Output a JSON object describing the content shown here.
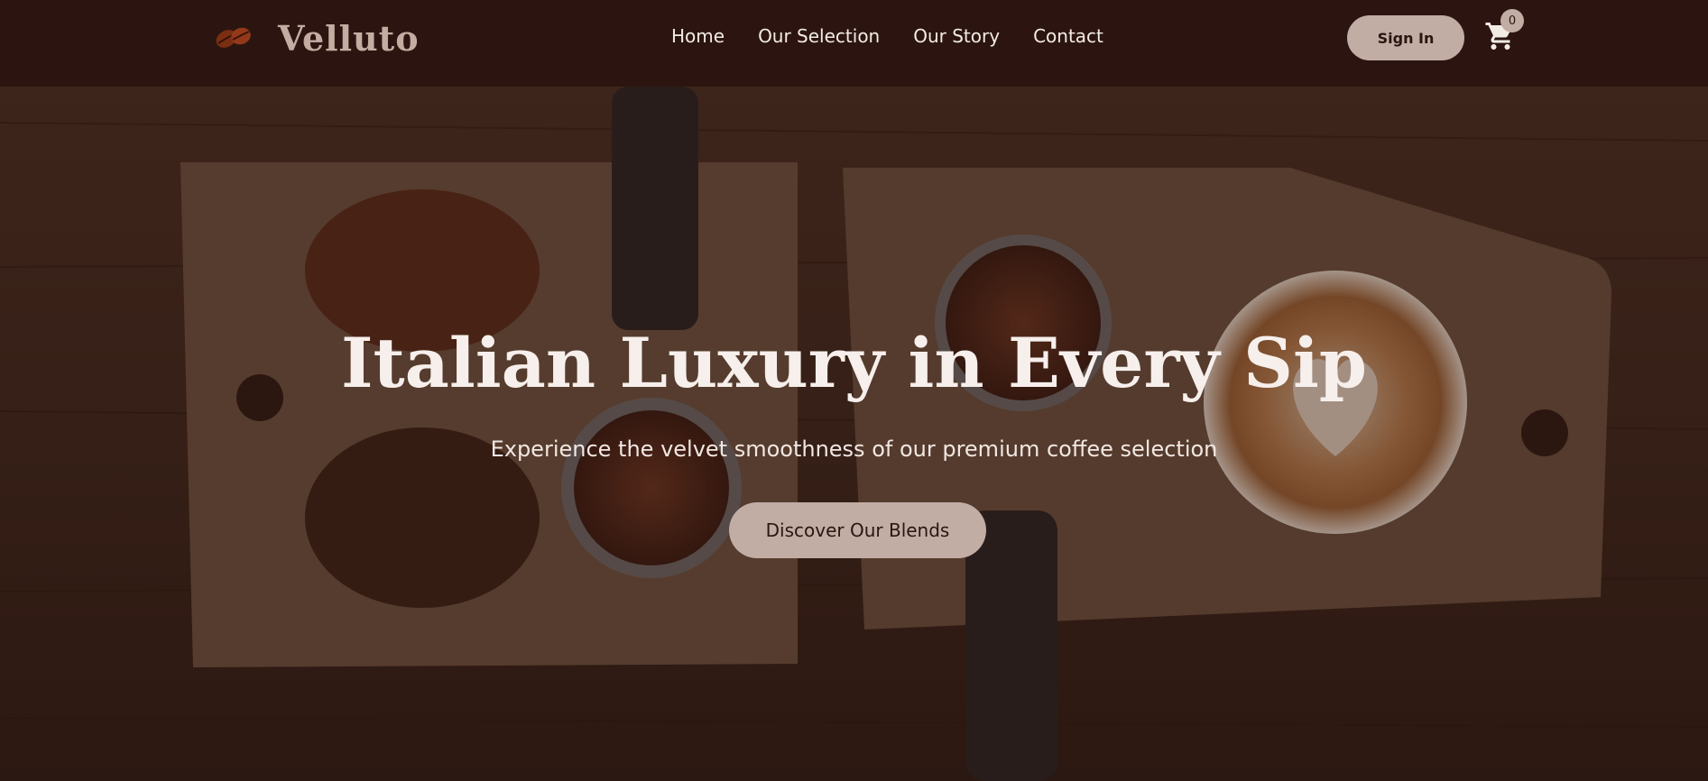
{
  "header": {
    "brand_name": "Velluto",
    "nav": [
      {
        "label": "Home"
      },
      {
        "label": "Our Selection"
      },
      {
        "label": "Our Story"
      },
      {
        "label": "Contact"
      }
    ],
    "sign_in_label": "Sign In",
    "cart_count": "0"
  },
  "hero": {
    "title": "Italian Luxury in Every Sip",
    "subtitle": "Experience the velvet smoothness of our premium coffee selection",
    "cta_label": "Discover Our Blends"
  },
  "colors": {
    "header_bg": "#2c1510",
    "accent": "#c2ada5",
    "brand_text": "#c4aca2"
  },
  "icons": {
    "logo": "coffee-beans-icon",
    "cart": "cart-icon"
  }
}
